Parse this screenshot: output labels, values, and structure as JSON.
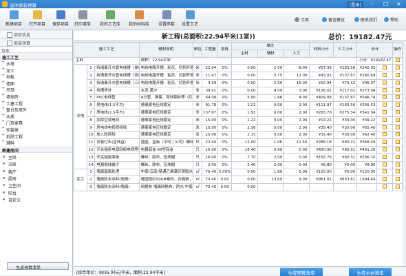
{
  "app": {
    "title": "迷你家装预算",
    "login": "[登录]"
  },
  "toolbar": {
    "buttons": [
      "新建项目",
      "打开项目",
      "保存项目",
      "打印清单",
      "我的工艺库",
      "我的材料库",
      "设置参数",
      "设置工艺"
    ],
    "right": [
      "工具",
      "留言建议",
      "联系我们",
      "帮助"
    ]
  },
  "sidebar": {
    "tabs": [
      "项目信息",
      "家装预算"
    ],
    "search": "搜索",
    "section1": "施工工艺",
    "crafts": [
      "水电",
      "泥工",
      "地板",
      "墙面",
      "吊顶",
      "墙地砖",
      "土建工程",
      "窗台及室外",
      "木质",
      "门及家具",
      "安装类",
      "拆除工程",
      "辅料"
    ],
    "section2": "新建房间",
    "rooms": [
      "主卧",
      "次卧",
      "客厅",
      "厨房",
      "卫生间",
      "阳台",
      "自定义"
    ],
    "button": "生成预算清单"
  },
  "header": {
    "title": "新工程(总面积:22.94平米(1室))",
    "total": "总价：19182.47元"
  },
  "table": {
    "headers": {
      "tech": "施工工艺",
      "material": "辅材说明",
      "unit": "单位",
      "qty": "工程量",
      "loss": "损耗",
      "unit_price": "单价",
      "main": "主材",
      "aux": "辅材",
      "labor": "人工",
      "mat_sub": "材料小计",
      "labor_sub": "人工小计",
      "total": "合计",
      "op": "操作"
    },
    "room": {
      "name": "主卧",
      "area": "面积：22.94平米",
      "subtotal": "小计：¥19182.47"
    },
    "group1": "水电",
    "group2": "泥工",
    "rows": [
      {
        "n": "1",
        "name": "拆墙面开水管电线槽（单线）",
        "desc": "电线电路开槽、粘灰、切割开槽",
        "unit": "米",
        "qty": "22.94",
        "loss": "0%",
        "main": "0.00",
        "aux": "2.50",
        "labor": "8.00",
        "ms": "¥57.36",
        "ls": "¥183.56",
        "tot": "¥240.92"
      },
      {
        "n": "2",
        "name": "拆墙面开水管电线槽（双线）",
        "desc": "电线电路开槽、粘灰、切割开槽",
        "unit": "米",
        "qty": "11.47",
        "loss": "0%",
        "main": "0.00",
        "aux": "3.75",
        "labor": "12.00",
        "ms": "¥43.01",
        "ls": "¥137.67",
        "tot": "¥180.69"
      },
      {
        "n": "3",
        "name": "拆墙面开水管电线槽（三线）",
        "desc": "电线电路开槽、粘灰、切割开槽",
        "unit": "米",
        "qty": "4.59",
        "loss": "0%",
        "main": "0.00",
        "aux": "5.00",
        "labor": "16.00",
        "ms": "¥22.94",
        "ls": "¥73.42",
        "tot": "¥96.37"
      },
      {
        "n": "4",
        "name": "线槽修补",
        "desc": "水泥 黄沙",
        "unit": "米",
        "qty": "39.01",
        "loss": "0%",
        "main": "0.00",
        "aux": "4.00",
        "labor": "3.00",
        "ms": "¥156.02",
        "ls": "¥117.02",
        "tot": "¥273.04"
      },
      {
        "n": "5",
        "name": "PVC电线管",
        "desc": "4分管、弹簧、穿线钢丝等（红 蓝管），接头、胶水等",
        "unit": "米",
        "qty": "64.08",
        "loss": "0%",
        "main": "5.00",
        "aux": "1.66",
        "labor": "4.00",
        "ms": "¥409.08",
        "ls": "¥137.67",
        "tot": "¥546.74"
      },
      {
        "n": "6",
        "name": "房电线(1.5平方)",
        "desc": "德泰家电压线稳定",
        "unit": "米",
        "qty": "91.78",
        "loss": "0%",
        "main": "1.22",
        "aux": "0.00",
        "labor": "2.00",
        "ms": "¥111.97",
        "ls": "¥183.56",
        "tot": "¥295.53"
      },
      {
        "n": "7",
        "name": "房电线(2.5平方)",
        "desc": "德泰家电压线稳定",
        "unit": "米",
        "qty": "137.67",
        "loss": "0%",
        "main": "1.93",
        "aux": "0.00",
        "labor": "2.00",
        "ms": "¥265.70",
        "ls": "¥275.34",
        "tot": "¥541.04"
      },
      {
        "n": "8",
        "name": "加厚空调电线",
        "desc": "德泰家电压线稳定",
        "unit": "米",
        "qty": "15.00",
        "loss": "0%",
        "main": "1.22",
        "aux": "0.00",
        "labor": "2.00",
        "ms": "¥19.22",
        "ls": "¥30.00",
        "tot": "¥49.22"
      },
      {
        "n": "9",
        "name": "房电线电视视频线",
        "desc": "德泰家电压线稳定",
        "unit": "米",
        "qty": "15.00",
        "loss": "0%",
        "main": "2.36",
        "aux": "0.00",
        "labor": "2.00",
        "ms": "¥35.40",
        "ls": "¥30.00",
        "tot": "¥65.40"
      },
      {
        "n": "10",
        "name": "放入防网线",
        "desc": "德泰家电压线稳定",
        "unit": "米",
        "qty": "15.00",
        "loss": "0%",
        "main": "2.15",
        "aux": "0.00",
        "labor": "2.00",
        "ms": "¥32.40",
        "ls": "¥30.00",
        "tot": "¥62.40"
      },
      {
        "n": "11",
        "name": "安装灯头(含线盒)",
        "desc": "插座、盒板（平时 / 公司）螺丝、胶布、开关",
        "unit": "只",
        "qty": "22.94",
        "loss": "0%",
        "main": "12.00",
        "aux": "1.06",
        "labor": "11.50",
        "ms": "¥288.18",
        "ls": "¥80.31",
        "tot": "¥368.49"
      },
      {
        "n": "12",
        "name": "开关插座电源网络电视等安装",
        "desc": "电器底盒 86型底盒",
        "unit": "只",
        "qty": "16.00",
        "loss": "0%",
        "main": "18.40",
        "aux": "3.80",
        "labor": "5.00",
        "ms": "¥400.90",
        "ls": "¥90.91",
        "tot": "¥491.26"
      },
      {
        "n": "13",
        "name": "开关插座面板",
        "desc": "螺丝、胶布、压线帽",
        "unit": "只",
        "qty": "16.00",
        "loss": "0%",
        "main": "7.70",
        "aux": "2.00",
        "labor": "0.00",
        "ms": "¥155.79",
        "ls": "¥80.31",
        "tot": "¥236.10"
      },
      {
        "n": "14",
        "name": "电器插线端子",
        "desc": "螺丝、胶布、压线帽",
        "unit": "只",
        "qty": "2.00",
        "loss": "0%",
        "main": "2.40",
        "aux": "2.00",
        "labor": "0.00",
        "ms": "¥8.80",
        "ls": "¥0.00",
        "tot": "¥8.80"
      },
      {
        "n": "1",
        "name": "墙面基面处理",
        "desc": "中南/汉高/易通乙烯基环保胶水，羊毛筒、滚筒等",
        "unit": "㎡",
        "qty": "70.40",
        "loss": "5.00%",
        "main": "0.00",
        "aux": "1.80",
        "labor": "0.00",
        "ms": "¥120.00",
        "ls": "¥0.00",
        "tot": "¥120.00"
      },
      {
        "n": "2",
        "name": "墙面防水涂料(地面)",
        "desc": "德国雨虹500#卷材，石棉粉，易士高、地砖粘剂(M20)环保胶粘剂(汉高/百得)",
        "unit": "㎡",
        "qty": "70.40",
        "loss": "0.00",
        "main": "0.00",
        "aux": "13.00",
        "labor": "9.00",
        "ms": "¥961.01",
        "ls": "¥633.61",
        "tot": "1594.64"
      },
      {
        "n": "3",
        "name": "墙面防水涂料(墙面)",
        "desc": "网格布 墙面网格布，防水 中南 801胶水",
        "unit": "㎡",
        "qty": "70.40",
        "loss": "0.00",
        "main": "0.00",
        "aux": "",
        "labor": "",
        "ms": "",
        "ls": "",
        "tot": ""
      }
    ]
  },
  "footer": {
    "info": "[综合单价：¥836.04元/平米，面积:22.94平米]",
    "btn1": "生成预算清单",
    "btn2": "生成主材清单"
  },
  "colors": {
    "accent": "#2f7ac4",
    "button": "#3b92df"
  }
}
